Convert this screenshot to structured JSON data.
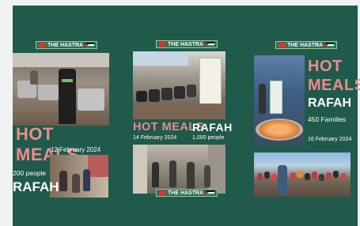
{
  "colors": {
    "board": "#1f5a4b",
    "accent_red": "#f08a8a",
    "text_white": "#ffffff",
    "page_bg": "#f1f2f2"
  },
  "logo": {
    "text": "THE HASTRA"
  },
  "panels": [
    {
      "headline": "HOT MEALS",
      "date": "12 February 2024",
      "people": "200 people",
      "location": "RAFAH"
    },
    {
      "headline": "HOT MEALS",
      "date": "14 February 2024",
      "location": "RAFAH",
      "people": "1,000 people"
    },
    {
      "headline_line1": "HOT",
      "headline_line2": "MEALS",
      "location": "RAFAH",
      "families": "450 Families",
      "date": "16 February 2024"
    }
  ]
}
